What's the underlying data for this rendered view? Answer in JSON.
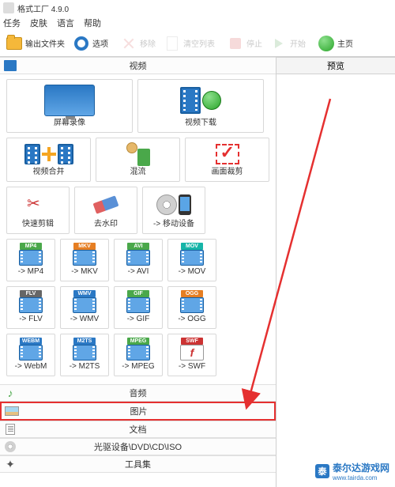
{
  "app": {
    "title": "格式工厂 4.9.0"
  },
  "menu": {
    "task": "任务",
    "skin": "皮肤",
    "lang": "语言",
    "help": "帮助"
  },
  "toolbar": {
    "output": "输出文件夹",
    "options": "选项",
    "remove": "移除",
    "clear": "清空列表",
    "stop": "停止",
    "start": "开始",
    "home": "主页"
  },
  "right": {
    "preview_tab": "预览"
  },
  "categories": {
    "video": "视频",
    "audio": "音频",
    "image": "图片",
    "document": "文档",
    "disc": "光驱设备\\DVD\\CD\\ISO",
    "toolkit": "工具集"
  },
  "video_items": {
    "screen_record": "屏幕录像",
    "video_download": "视频下载",
    "video_merge": "视频合并",
    "mix": "混流",
    "crop": "画面裁剪",
    "quick_cut": "快速剪辑",
    "remove_wm": "去水印",
    "mobile": "-> 移动设备",
    "mp4": "-> MP4",
    "mkv": "-> MKV",
    "avi": "-> AVI",
    "mov": "-> MOV",
    "flv": "-> FLV",
    "wmv": "-> WMV",
    "gif": "-> GIF",
    "ogg": "-> OGG",
    "webm": "-> WebM",
    "m2ts": "-> M2TS",
    "mpeg": "-> MPEG",
    "swf": "-> SWF",
    "tag_mp4": "MP4",
    "tag_mkv": "MKV",
    "tag_avi": "AVI",
    "tag_mov": "MOV",
    "tag_flv": "FLV",
    "tag_wmv": "WMV",
    "tag_gif": "GIF",
    "tag_ogg": "OGG",
    "tag_webm": "WEBM",
    "tag_m2ts": "M2TS",
    "tag_mpeg": "MPEG",
    "tag_swf": "SWF"
  },
  "watermark": {
    "site_cn": "泰尔达游戏网",
    "site_url": "www.tairda.com",
    "logo": "泰"
  }
}
